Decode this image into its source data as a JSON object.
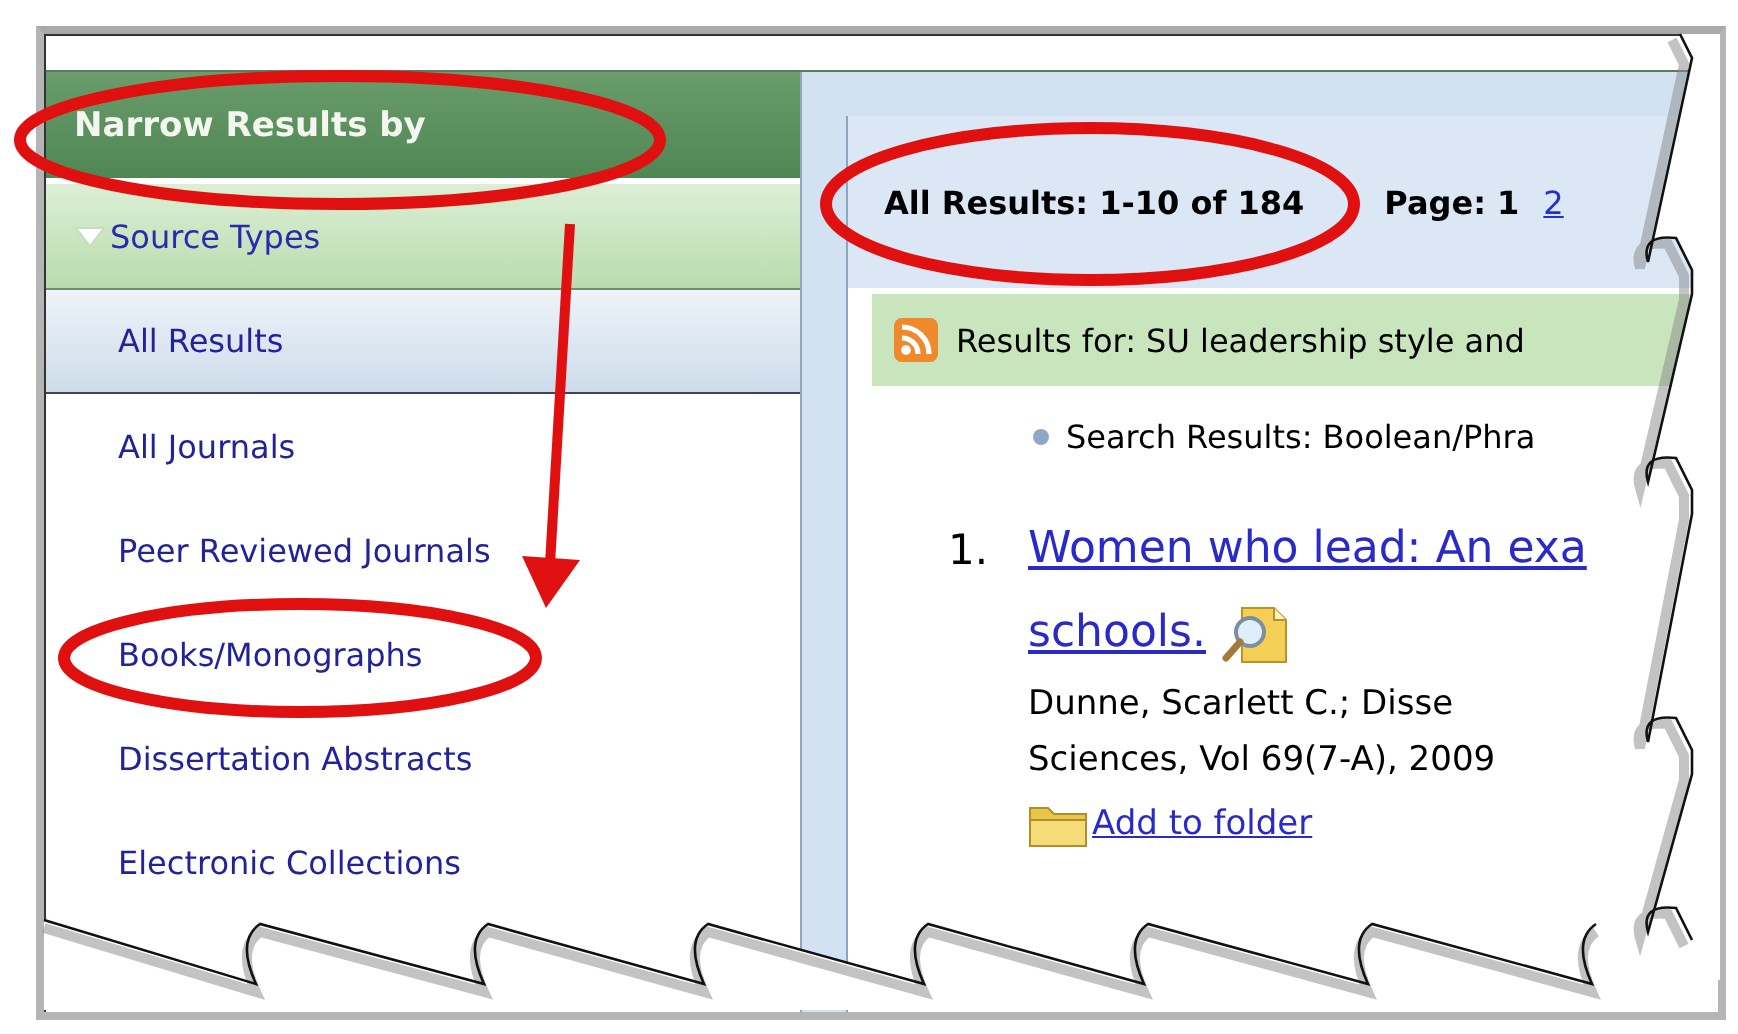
{
  "sidebar": {
    "title": "Narrow Results by",
    "section": {
      "label": "Source Types",
      "expanded": true
    },
    "items": [
      {
        "label": "All Results",
        "selected": true
      },
      {
        "label": "All Journals",
        "selected": false
      },
      {
        "label": "Peer Reviewed Journals",
        "selected": false
      },
      {
        "label": "Books/Monographs",
        "selected": false
      },
      {
        "label": "Dissertation Abstracts",
        "selected": false
      },
      {
        "label": "Electronic Collections",
        "selected": false
      }
    ]
  },
  "results": {
    "summary": "All Results: 1-10 of 184",
    "page_label": "Page: 1",
    "pages": [
      "2"
    ],
    "query": "Results for:  SU leadership style and",
    "search_note": "Search Results: Boolean/Phra",
    "items": [
      {
        "number": "1.",
        "title_lines": [
          "Women who lead: An exa",
          "schools."
        ],
        "citation_lines": [
          "Dunne, Scarlett C.; Disse",
          "Sciences, Vol 69(7-A), 2009"
        ],
        "folder_link": "Add to folder"
      }
    ]
  }
}
